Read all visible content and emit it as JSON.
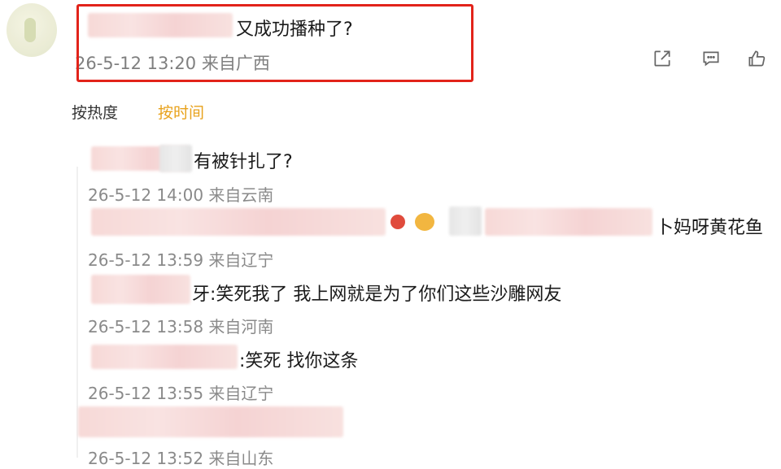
{
  "original_post": {
    "text": "又成功播种了?",
    "meta": "26-5-12 13:20 来自广西"
  },
  "actions": {
    "share_icon": "share-icon",
    "comment_icon": "comment-icon",
    "like_icon": "thumbs-up-icon"
  },
  "sort": {
    "hot_label": "按热度",
    "time_label": "按时间",
    "active": "time"
  },
  "comments": [
    {
      "text": "有被针扎了?",
      "meta": "26-5-12 14:00 来自云南"
    },
    {
      "text": "卜妈呀黄花鱼",
      "meta": "26-5-12 13:59 来自辽宁"
    },
    {
      "text": "牙:笑死我了 我上网就是为了你们这些沙雕网友",
      "meta": "26-5-12 13:58 来自河南"
    },
    {
      "text": ":笑死 找你这条",
      "meta": "26-5-12 13:55 来自辽宁"
    },
    {
      "text": "",
      "meta": "26-5-12 13:52 来自山东"
    }
  ],
  "colors": {
    "highlight_border": "#e2231a",
    "active_sort": "#e8a21c",
    "meta_text": "#8a8a8a"
  }
}
